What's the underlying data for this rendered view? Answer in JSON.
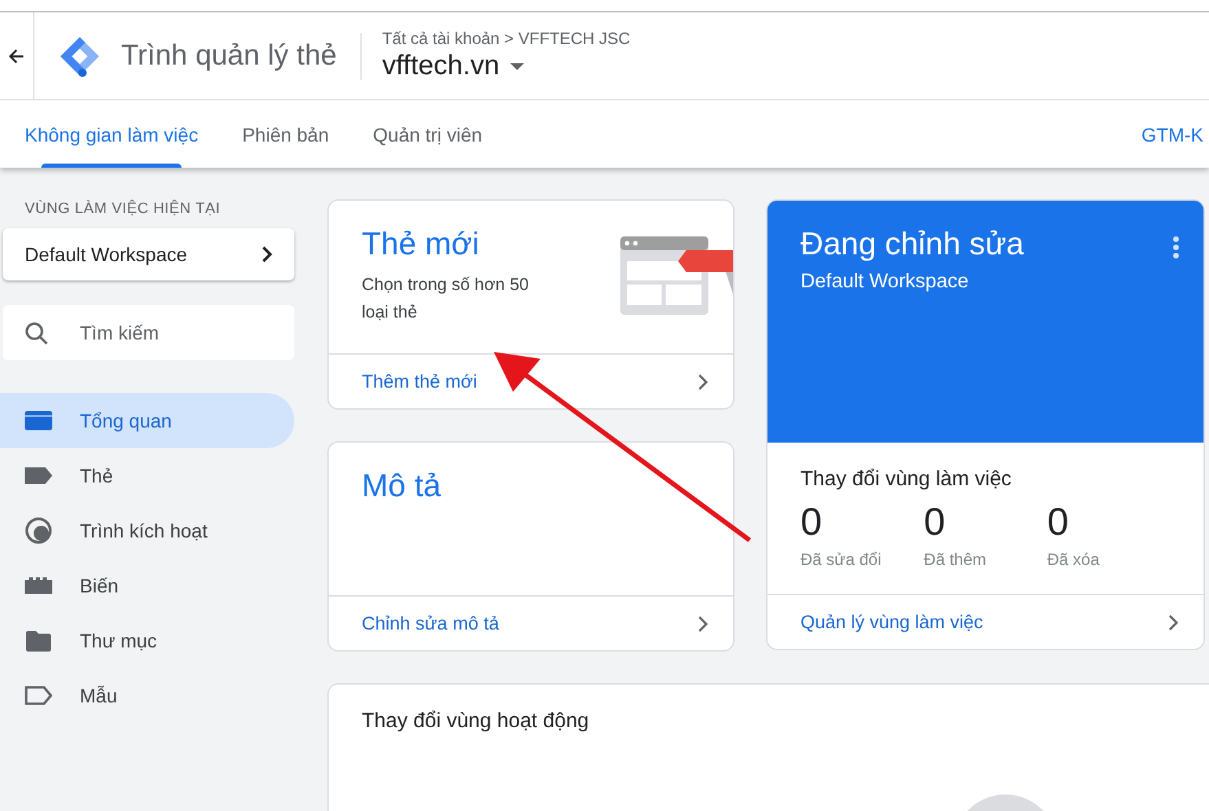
{
  "header": {
    "app_title": "Trình quản lý thẻ",
    "breadcrumb": "Tất cả tài khoản > VFFTECH JSC",
    "container": "vfftech.vn"
  },
  "tabs": [
    {
      "label": "Không gian làm việc",
      "selected": true
    },
    {
      "label": "Phiên bản",
      "selected": false
    },
    {
      "label": "Quản trị viên",
      "selected": false
    }
  ],
  "container_id": "GTM-K",
  "sidebar": {
    "section_label": "VÙNG LÀM VIỆC HIỆN TẠI",
    "workspace": "Default Workspace",
    "search": {
      "placeholder": "Tìm kiếm"
    },
    "items": [
      {
        "label": "Tổng quan",
        "selected": true
      },
      {
        "label": "Thẻ",
        "selected": false
      },
      {
        "label": "Trình kích hoạt",
        "selected": false
      },
      {
        "label": "Biến",
        "selected": false
      },
      {
        "label": "Thư mục",
        "selected": false
      },
      {
        "label": "Mẫu",
        "selected": false
      }
    ]
  },
  "new_tag_card": {
    "title": "Thẻ mới",
    "description": "Chọn trong số hơn 50 loại thẻ",
    "action": "Thêm thẻ mới"
  },
  "description_card": {
    "title": "Mô tả",
    "action": "Chỉnh sửa mô tả"
  },
  "editing_card": {
    "title": "Đang chỉnh sửa",
    "workspace": "Default Workspace",
    "changes_title": "Thay đổi vùng làm việc",
    "stats": [
      {
        "value": "0",
        "label": "Đã sửa đổi"
      },
      {
        "value": "0",
        "label": "Đã thêm"
      },
      {
        "value": "0",
        "label": "Đã xóa"
      }
    ],
    "action": "Quản lý vùng làm việc"
  },
  "activity_card": {
    "title": "Thay đổi vùng hoạt động"
  }
}
